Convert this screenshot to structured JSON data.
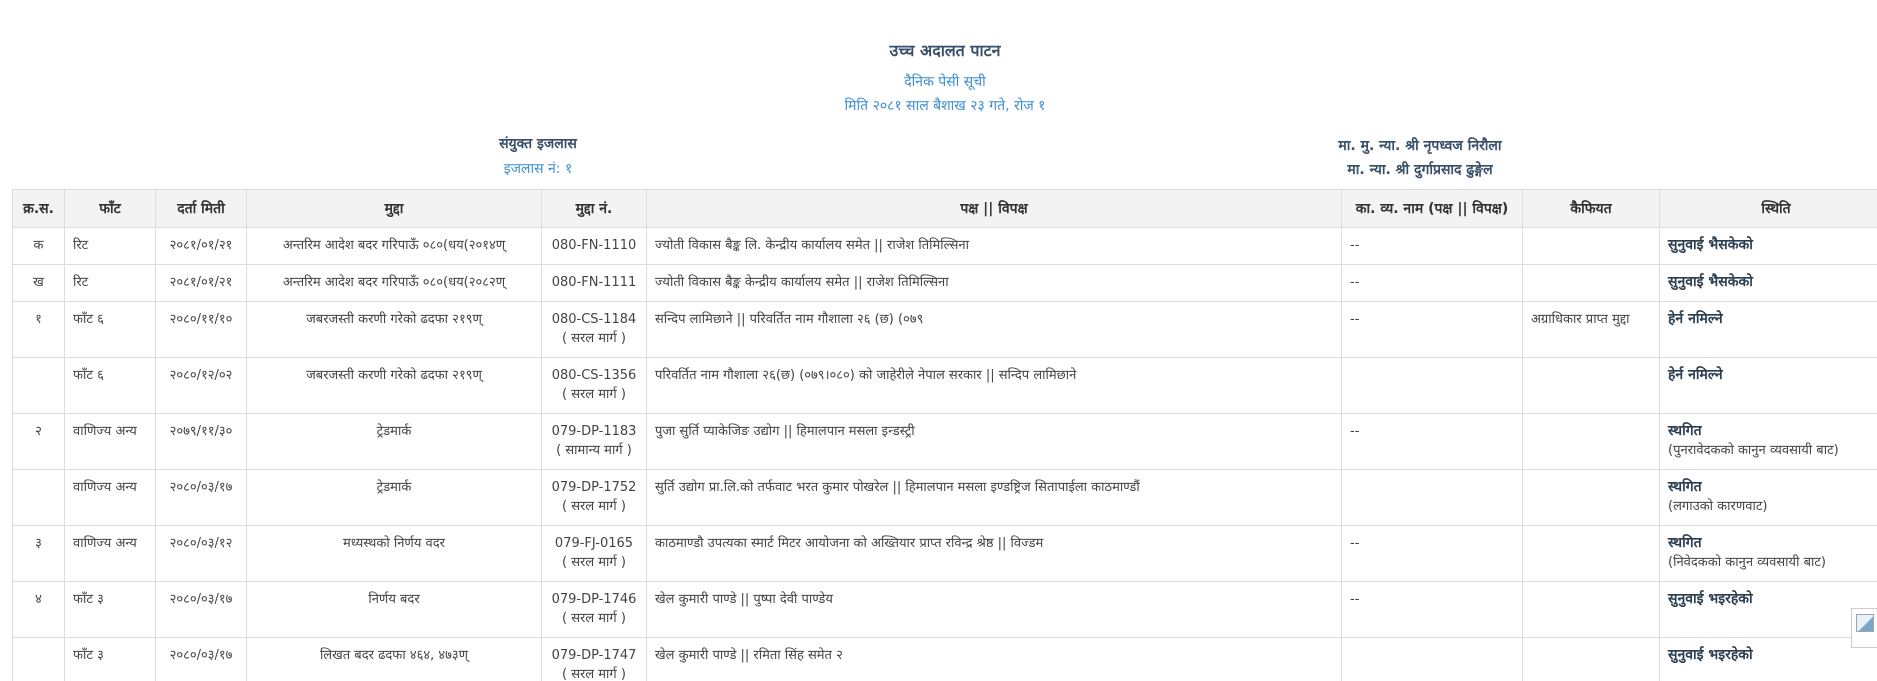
{
  "header": {
    "court_name": "उच्च अदालत पाटन",
    "list_title": "दैनिक पेसी सूची",
    "date_line": "मिति २०८१ साल बैशाख २३ गते, रोज १"
  },
  "bench": {
    "title": "संयुक्त इजलास",
    "number": "इजलास नं: १",
    "judges": [
      "मा. मु. न्या. श्री नृपध्वज निरौला",
      "मा. न्या. श्री दुर्गाप्रसाद ढुङ्गेल"
    ]
  },
  "table": {
    "headers": [
      "क्र.स.",
      "फाँट",
      "दर्ता मिती",
      "मुद्दा",
      "मुद्दा नं.",
      "पक्ष || विपक्ष",
      "का. व्य. नाम (पक्ष || विपक्ष)",
      "कैफियत",
      "स्थिति"
    ],
    "rows": [
      {
        "serial": "क",
        "section": "रिट",
        "reg_date": "२०८१/०१/२१",
        "case": "अन्तरिम आदेश बदर गरिपाऊँ ०८०(धय(२०१४ण्",
        "case_no": "080-FN-1110",
        "case_track": "",
        "parties": "ज्योती विकास बैङ्क लि. केन्द्रीय कार्यालय समेत  || राजेश तिमिल्सिना",
        "lawyer": "--",
        "remarks": "",
        "status": "सुनुवाई भैसकेको",
        "status_note": ""
      },
      {
        "serial": "ख",
        "section": "रिट",
        "reg_date": "२०८१/०१/२१",
        "case": "अन्तरिम आदेश बदर गरिपाऊँ ०८०(धय(२०८२ण्",
        "case_no": "080-FN-1111",
        "case_track": "",
        "parties": "ज्योती विकास बैङ्क केन्द्रीय कार्यालय समेत  || राजेश तिमिल्सिना",
        "lawyer": "--",
        "remarks": "",
        "status": "सुनुवाई भैसकेको",
        "status_note": ""
      },
      {
        "serial": "१",
        "section": "फाँट ६",
        "reg_date": "२०८०/११/१०",
        "case": "जबरजस्ती करणी गरेको ढदफा २१९ण्",
        "case_no": "080-CS-1184",
        "case_track": "( सरल मार्ग )",
        "parties": "सन्दिप लामिछाने  || परिवर्तित नाम गौशाला २६ (छ) (०७९",
        "lawyer": "--",
        "remarks": "अग्राधिकार प्राप्त मुद्दा",
        "status": "हेर्न नमिल्ने",
        "status_note": ""
      },
      {
        "serial": "",
        "section": "फाँट ६",
        "reg_date": "२०८०/१२/०२",
        "case": "जबरजस्ती करणी गरेको ढदफा २१९ण्",
        "case_no": "080-CS-1356",
        "case_track": "( सरल मार्ग )",
        "parties": "परिवर्तित नाम गौशाला २६(छ) (०७९।०८०) को जाहेरीले नेपाल सरकार  || सन्दिप लामिछाने",
        "lawyer": "",
        "remarks": "",
        "status": "हेर्न नमिल्ने",
        "status_note": ""
      },
      {
        "serial": "२",
        "section": "वाणिज्य अन्य",
        "reg_date": "२०७९/११/३०",
        "case": "ट्रेडमार्क",
        "case_no": "079-DP-1183",
        "case_track": "( सामान्य मार्ग )",
        "parties": "पुजा सुर्ति प्याकेजिङ उद्योग  || हिमालपान मसला इन्डस्ट्री",
        "lawyer": "--",
        "remarks": "",
        "status": "स्थगित",
        "status_note": "(पुनरावेदकको कानुन व्यवसायी बाट)"
      },
      {
        "serial": "",
        "section": "वाणिज्य अन्य",
        "reg_date": "२०८०/०३/१७",
        "case": "ट्रेडमार्क",
        "case_no": "079-DP-1752",
        "case_track": "( सरल मार्ग )",
        "parties": "सुर्ति उद्योग प्रा.लि.को तर्फवाट भरत कुमार पोखरेल  || हिमालपान मसला इण्डष्ट्रिज सितापाईला काठमाण्डौं",
        "lawyer": "",
        "remarks": "",
        "status": "स्थगित",
        "status_note": "(लगाउको कारणवाट)"
      },
      {
        "serial": "३",
        "section": "वाणिज्य अन्य",
        "reg_date": "२०८०/०३/१२",
        "case": "मध्यस्थको निर्णय वदर",
        "case_no": "079-FJ-0165",
        "case_track": "( सरल मार्ग )",
        "parties": "काठमाण्डौ उपत्यका स्मार्ट मिटर आयोजना को अख्तियार प्राप्त रविन्द्र श्रेष्ठ  || विज्डम",
        "lawyer": "--",
        "remarks": "",
        "status": "स्थगित",
        "status_note": "(निवेदकको कानुन व्यवसायी बाट)"
      },
      {
        "serial": "४",
        "section": "फाँट ३",
        "reg_date": "२०८०/०३/१७",
        "case": "निर्णय बदर",
        "case_no": "079-DP-1746",
        "case_track": "( सरल मार्ग )",
        "parties": "खेल कुमारी पाण्डे  || पुष्पा देवी पाण्डेय",
        "lawyer": "--",
        "remarks": "",
        "status": "सुनुवाई भइरहेको",
        "status_note": ""
      },
      {
        "serial": "",
        "section": "फाँट ३",
        "reg_date": "२०८०/०३/१७",
        "case": "लिखत बदर ढदफा ४६४, ४७३ण्",
        "case_no": "079-DP-1747",
        "case_track": "( सरल मार्ग )",
        "parties": "खेल कुमारी पाण्डे  || रमिता सिंह समेत २",
        "lawyer": "",
        "remarks": "",
        "status": "सुनुवाई भइरहेको",
        "status_note": ""
      }
    ]
  }
}
